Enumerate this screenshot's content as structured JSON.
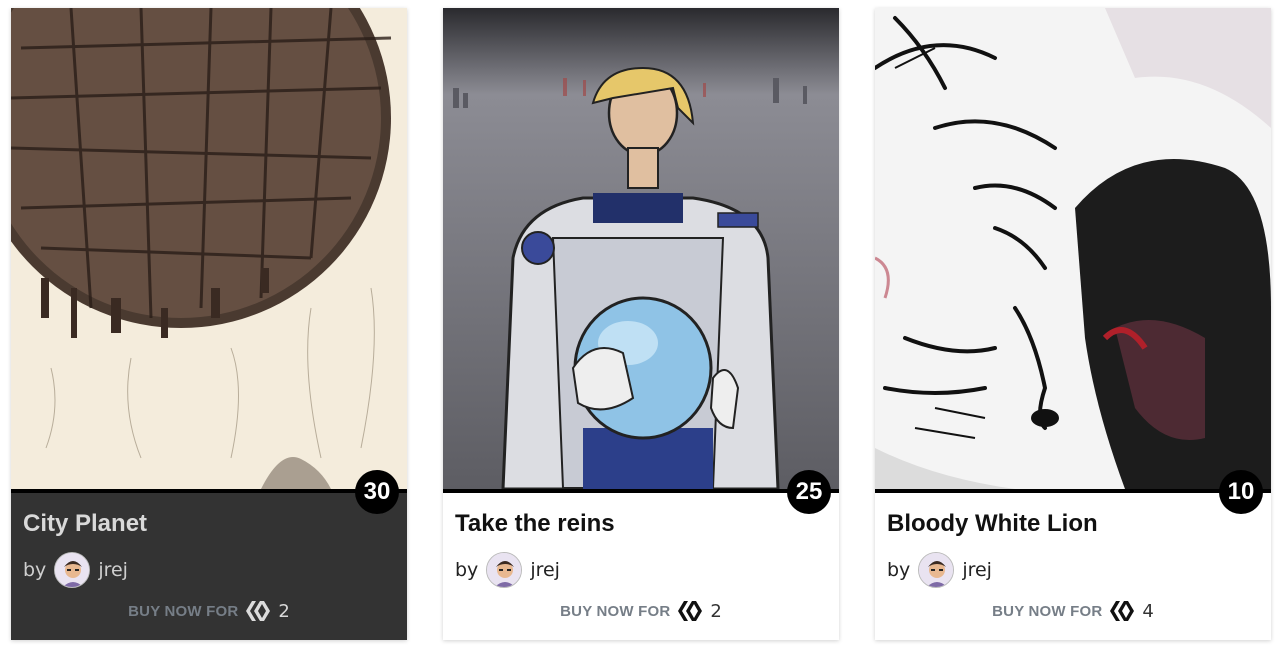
{
  "cards": [
    {
      "title": "City Planet",
      "count": "30",
      "by": "by",
      "author": "jrej",
      "buy_label": "BUY NOW FOR",
      "price": "2",
      "currency_icon": "hive-icon",
      "image": "city-planet-artwork"
    },
    {
      "title": "Take the reins",
      "count": "25",
      "by": "by",
      "author": "jrej",
      "buy_label": "BUY NOW FOR",
      "price": "2",
      "currency_icon": "hive-icon",
      "image": "astronaut-artwork"
    },
    {
      "title": "Bloody White Lion",
      "count": "10",
      "by": "by",
      "author": "jrej",
      "buy_label": "BUY NOW FOR",
      "price": "4",
      "currency_icon": "hive-icon",
      "image": "white-lion-artwork"
    }
  ],
  "colors": {
    "dark_card": "#333333",
    "buy_label": "#767e87",
    "badge": "#000000"
  }
}
